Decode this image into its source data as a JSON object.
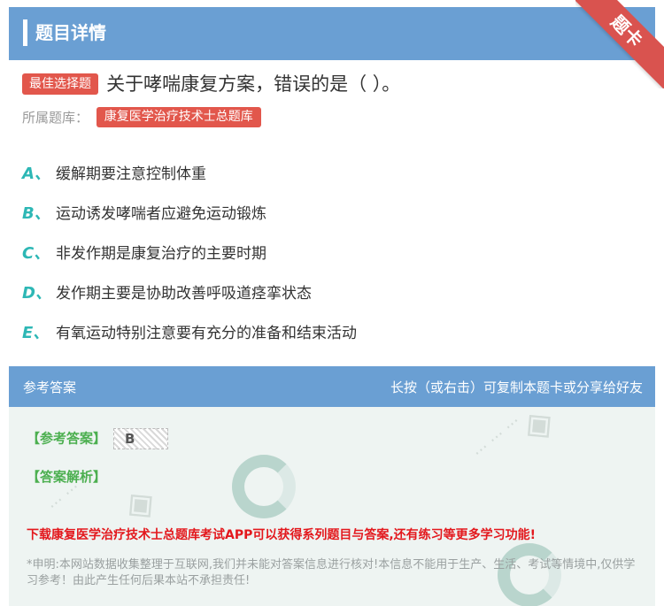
{
  "header": {
    "title": "题目详情"
  },
  "ribbon": {
    "label": "题卡"
  },
  "question": {
    "type_tag": "最佳选择题",
    "text": "关于哮喘康复方案，错误的是（ ）。"
  },
  "bank": {
    "label": "所属题库：",
    "name": "康复医学治疗技术士总题库"
  },
  "options": [
    {
      "letter": "A、",
      "text": "缓解期要注意控制体重"
    },
    {
      "letter": "B、",
      "text": "运动诱发哮喘者应避免运动锻炼"
    },
    {
      "letter": "C、",
      "text": "非发作期是康复治疗的主要时期"
    },
    {
      "letter": "D、",
      "text": "发作期主要是协助改善呼吸道痉挛状态"
    },
    {
      "letter": "E、",
      "text": "有氧运动特别注意要有充分的准备和结束活动"
    }
  ],
  "answer": {
    "header_left": "参考答案",
    "header_right": "长按（或右击）可复制本题卡或分享给好友",
    "answer_label": "【参考答案】",
    "answer_value": "B",
    "analysis_label": "【答案解析】",
    "promo": "下载康复医学治疗技术士总题库考试APP可以获得系列题目与答案,还有练习等更多学习功能!",
    "disclaimer": "*申明:本网站数据收集整理于互联网,我们并未能对答案信息进行核对!本信息不能用于生产、生活、考试等情境中,仅供学习参考！由此产生任何后果本站不承担责任!"
  },
  "colors": {
    "header_bg": "#6a9fd3",
    "tag_red": "#e2574c",
    "option_letter": "#2db7b5",
    "answer_green": "#4caf50",
    "promo_red": "#e3181d"
  }
}
